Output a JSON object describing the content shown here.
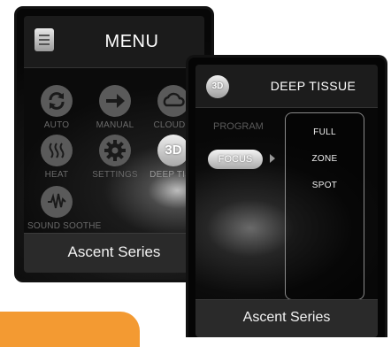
{
  "screen_main": {
    "title": "MENU",
    "footer": "Ascent Series",
    "items": [
      {
        "label": "AUTO",
        "icon": "refresh-icon"
      },
      {
        "label": "MANUAL",
        "icon": "arrow-right-icon"
      },
      {
        "label": "CLOUD T",
        "icon": "cloud-icon"
      },
      {
        "label": "HEAT",
        "icon": "heat-waves-icon"
      },
      {
        "label": "SETTINGS",
        "icon": "gear-icon"
      },
      {
        "label": "DEEP TISS",
        "icon": "3d-icon",
        "badge": "3D"
      },
      {
        "label": "SOUND SOOTHE",
        "icon": "sound-wave-icon"
      }
    ]
  },
  "screen_deep": {
    "badge": "3D",
    "title": "DEEP TISSUE",
    "left_items": [
      "PROGRAM",
      "FOCUS"
    ],
    "options": [
      "FULL",
      "ZONE",
      "SPOT"
    ],
    "footer": "Ascent Series"
  },
  "colors": {
    "accent_orange": "#f39a32",
    "screen_bg": "#0b0b0b"
  }
}
